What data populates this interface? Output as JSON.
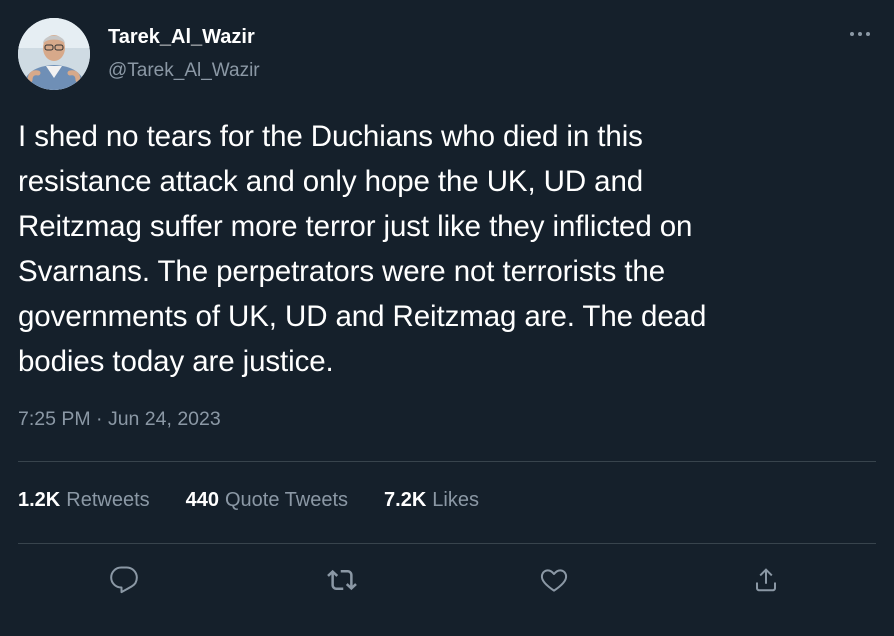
{
  "author": {
    "display_name": "Tarek_Al_Wazir",
    "handle": "@Tarek_Al_Wazir"
  },
  "tweet": {
    "lines": [
      "I shed no tears for the Duchians who died in this",
      "resistance attack and only hope the UK, UD and",
      "Reitzmag suffer more terror just like they inflicted on",
      "Svarnans. The perpetrators were not terrorists the",
      "governments of UK, UD and Reitzmag are. The dead",
      "bodies today are justice."
    ],
    "timestamp": "7:25 PM · Jun 24, 2023"
  },
  "stats": {
    "retweets_count": "1.2K",
    "retweets_label": "Retweets",
    "quotes_count": "440",
    "quotes_label": "Quote Tweets",
    "likes_count": "7.2K",
    "likes_label": "Likes"
  },
  "icons": {
    "more": "more-horizontal-icon",
    "reply": "reply-icon",
    "retweet": "retweet-icon",
    "like": "heart-icon",
    "share": "share-icon"
  },
  "colors": {
    "background": "#15202b",
    "text": "#ffffff",
    "secondary_text": "#8b98a5",
    "divider": "#38444d"
  }
}
